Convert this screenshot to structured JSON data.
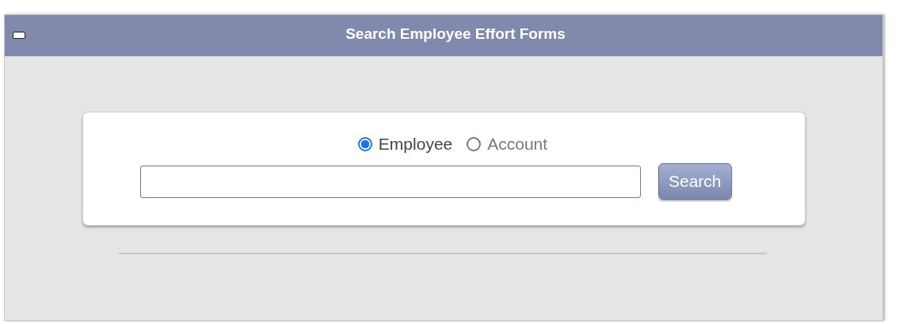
{
  "window": {
    "title": "Search Employee Effort Forms"
  },
  "search_by": [
    {
      "label": "Employee",
      "selected": true
    },
    {
      "label": "Account",
      "selected": false
    }
  ],
  "buttons": [
    "Search"
  ]
}
